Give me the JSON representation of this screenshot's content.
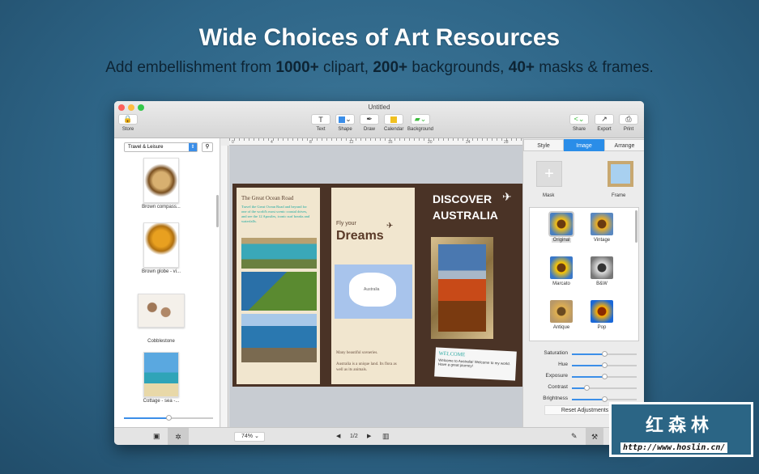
{
  "headline": "Wide Choices of Art Resources",
  "subheadline": {
    "p1": "Add embellishment from ",
    "b1": "1000+",
    "p2": " clipart, ",
    "b2": "200+",
    "p3": " backgrounds, ",
    "b3": "40+",
    "p4": " masks & frames."
  },
  "window": {
    "title": "Untitled"
  },
  "toolbar": {
    "store": "Store",
    "text": "Text",
    "shape": "Shape",
    "draw": "Draw",
    "calendar": "Calendar",
    "background": "Background",
    "share": "Share",
    "export": "Export",
    "print": "Print"
  },
  "left_panel": {
    "category": "Travel & Leisure",
    "items": [
      "Brown compass...",
      "Brown globe - vi...",
      "Cobblestone",
      "Cottage - sea -..."
    ]
  },
  "ruler": [
    "0",
    "4",
    "8",
    "12",
    "16",
    "20",
    "24",
    "28"
  ],
  "brochure": {
    "p1_title": "The Great Ocean Road",
    "p1_body": "Travel the Great Ocean Road and beyond for one of the world's most scenic coastal drives, and see the 12 Apostles, iconic surf breaks and waterfalls.",
    "p2_fly": "Fly your",
    "p2_dreams": "Dreams",
    "p2_map": "Australia",
    "p2_caption1": "Many beautiful sceneries.",
    "p2_caption2": "Australia is a unique land. Its flora as well as its animals.",
    "p3_title1": "DISCOVER",
    "p3_title2": "AUSTRALIA",
    "welcome": "WELCOME",
    "welcome_body": "Welcome to Australia! Welcome to my world. Have a great journey!"
  },
  "right_panel": {
    "tabs": [
      "Style",
      "Image",
      "Arrange"
    ],
    "active_tab": "Image",
    "mask": "Mask",
    "frame": "Frame",
    "filters": [
      "Original",
      "Vintage",
      "Marcato",
      "B&W",
      "Antique",
      "Pop"
    ],
    "selected_filter": "Original",
    "adjustments": [
      {
        "name": "Saturation",
        "value": 0.5
      },
      {
        "name": "Hue",
        "value": 0.5
      },
      {
        "name": "Exposure",
        "value": 0.5
      },
      {
        "name": "Contrast",
        "value": 0.22
      },
      {
        "name": "Brightness",
        "value": 0.5
      }
    ],
    "reset": "Reset Adjustments"
  },
  "bottom": {
    "zoom": "74%",
    "page": "1/2"
  },
  "left_slider_value": 0.5,
  "watermark": {
    "name": "红森林",
    "url": "http://www.hoslin.cn/"
  }
}
